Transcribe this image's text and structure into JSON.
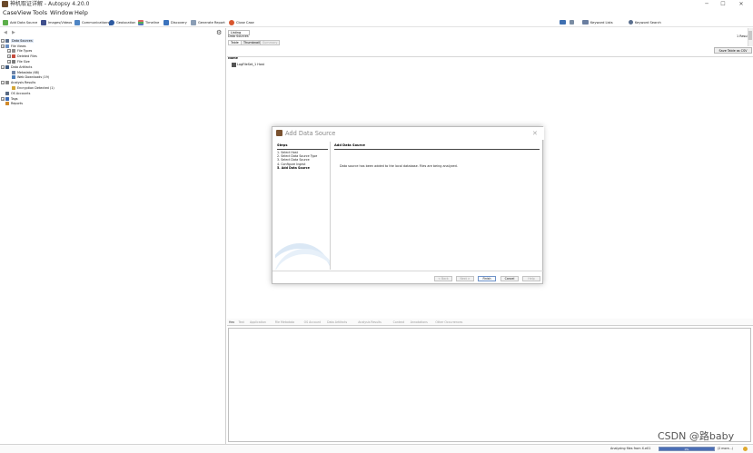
{
  "window": {
    "title": "神机取证详解 - Autopsy 4.20.0",
    "minimize": "─",
    "maximize": "☐",
    "close": "✕"
  },
  "menu": [
    "Case",
    "View",
    "Tools",
    "Window",
    "Help"
  ],
  "toolbar": {
    "add_data_source": "Add Data Source",
    "images_videos": "Images/Videos",
    "communications": "Communications",
    "geolocation": "Geolocation",
    "timeline": "Timeline",
    "discovery": "Discovery",
    "generate_report": "Generate Report",
    "close_case": "Close Case",
    "keyword_lists": "Keyword Lists",
    "keyword_search": "Keyword Search"
  },
  "tree": {
    "items": [
      {
        "label": "Data Sources",
        "level": 0,
        "expander": "−",
        "icon": "data-sources-icon",
        "color": "#5a6f8e",
        "selected": true
      },
      {
        "label": "File Views",
        "level": 0,
        "expander": "+",
        "icon": "file-views-icon",
        "color": "#6a8fc2"
      },
      {
        "label": "File Types",
        "level": 1,
        "expander": "+",
        "icon": "file-types-icon",
        "color": "#8e8e8e"
      },
      {
        "label": "Deleted Files",
        "level": 1,
        "expander": "+",
        "icon": "deleted-files-icon",
        "color": "#c54d3e"
      },
      {
        "label": "File Size",
        "level": 1,
        "expander": "+",
        "icon": "file-size-icon",
        "color": "#7d7d7d"
      },
      {
        "label": "Data Artifacts",
        "level": 0,
        "expander": "−",
        "icon": "data-artifacts-icon",
        "color": "#3e5a80"
      },
      {
        "label": "Metadata (68)",
        "level": 1,
        "expander": "",
        "icon": "metadata-icon",
        "color": "#6e84a7"
      },
      {
        "label": "Web Downloads (19)",
        "level": 1,
        "expander": "",
        "icon": "web-downloads-icon",
        "color": "#4b7db8"
      },
      {
        "label": "Analysis Results",
        "level": 0,
        "expander": "−",
        "icon": "analysis-results-icon",
        "color": "#888888"
      },
      {
        "label": "Encryption Detected (1)",
        "level": 1,
        "expander": "",
        "icon": "encryption-icon",
        "color": "#d2a536"
      },
      {
        "label": "OS Accounts",
        "level": 0,
        "expander": "",
        "icon": "os-accounts-icon",
        "color": "#5a6b82"
      },
      {
        "label": "Tags",
        "level": 0,
        "expander": "+",
        "icon": "tags-icon",
        "color": "#3d6bb3"
      },
      {
        "label": "Reports",
        "level": 0,
        "expander": "",
        "icon": "reports-icon",
        "color": "#d08a2a"
      }
    ]
  },
  "listing": {
    "tab": "Listing",
    "path": "Data Sources",
    "result_count": "1 Result",
    "subtabs": [
      "Table",
      "Thumbnail",
      "Summary"
    ],
    "save_table": "Save Table as CSV",
    "col_name": "Name",
    "row": "LogFileSet_1 Host"
  },
  "bottom": {
    "tabs": [
      "Hex",
      "Text",
      "Application",
      "File Metadata",
      "OS Account",
      "Data Artifacts",
      "Analysis Results",
      "Context",
      "Annotations",
      "Other Occurrences"
    ]
  },
  "dialog": {
    "title": "Add Data Source",
    "close": "✕",
    "steps_header": "Steps",
    "steps": [
      {
        "label": "1.   Select Host",
        "current": false
      },
      {
        "label": "2.   Select Data Source Type",
        "current": false
      },
      {
        "label": "3.   Select Data Source",
        "current": false
      },
      {
        "label": "4.   Configure Ingest",
        "current": false
      },
      {
        "label": "5.   Add Data Source",
        "current": true
      }
    ],
    "content_header": "Add Data Source",
    "message": "Data source has been added to the local database. Files are being analyzed.",
    "buttons": {
      "back": "< Back",
      "next": "Next >",
      "finish": "Finish",
      "cancel": "Cancel",
      "help": "Help"
    }
  },
  "status": {
    "text": "Analyzing files from X.e01",
    "progress_label": "0%",
    "progress": 0.0,
    "count": "(2 more...)"
  },
  "watermark": "CSDN @路baby",
  "colors": {
    "accent": "#4c6fb5",
    "selection": "#dce6f4"
  }
}
